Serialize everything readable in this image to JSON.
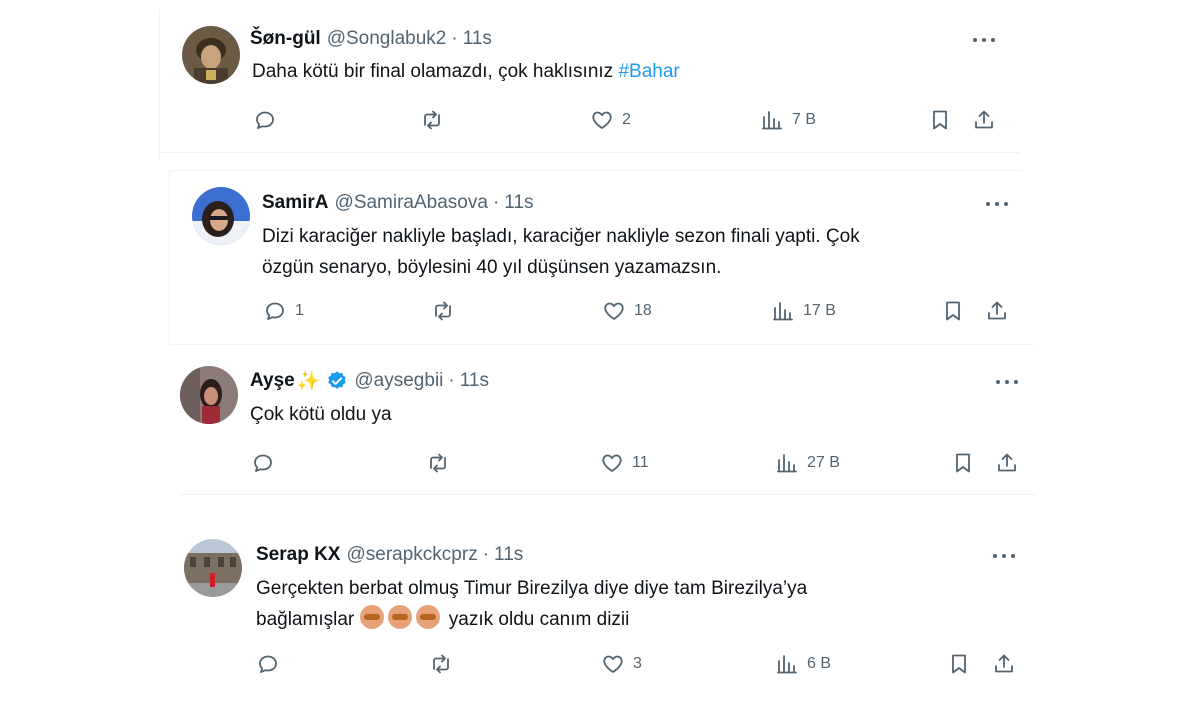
{
  "tweets": [
    {
      "name": "Šøn-gül",
      "handle": "@Songlabuk2",
      "separator": "·",
      "time": "11s",
      "text_before": "Daha kötü bir final olamazdı, çok haklısınız ",
      "hashtag": "#Bahar",
      "replies": "",
      "likes": "2",
      "views": "7 B"
    },
    {
      "name": "SamirA",
      "handle": "@SamiraAbasova",
      "separator": "·",
      "time": "11s",
      "text_line1": "Dizi karaciğer nakliyle başladı, karaciğer nakliyle sezon finali yapti. Çok",
      "text_line2": "özgün senaryo, böylesini 40 yıl düşünsen yazamazsın.",
      "replies": "1",
      "likes": "18",
      "views": "17 B"
    },
    {
      "name": "Ayşe",
      "name_emoji": "✨",
      "handle": "@aysegbii",
      "separator": "·",
      "time": "11s",
      "text": "Çok kötü oldu ya",
      "replies": "",
      "likes": "11",
      "views": "27 B"
    },
    {
      "name": "Serap KX",
      "handle": "@serapkckcprz",
      "separator": "·",
      "time": "11s",
      "text_line1": "Gerçekten berbat olmuş Timur Birezilya diye diye tam Birezilya’ya",
      "text_line2_before": "bağlamışlar",
      "text_line2_after": "yazık oldu canım dizii",
      "emoji_names": [
        "see-no-evil-monkey",
        "see-no-evil-monkey",
        "see-no-evil-monkey"
      ],
      "replies": "",
      "likes": "3",
      "views": "6 B"
    }
  ],
  "icons": {
    "reply": "reply-icon",
    "retweet": "retweet-icon",
    "like": "heart-icon",
    "views": "views-icon",
    "bookmark": "bookmark-icon",
    "share": "share-icon",
    "more": "more-icon"
  },
  "colors": {
    "text": "#0f1419",
    "muted": "#536471",
    "link": "#1d9bf0",
    "verified": "#1d9bf0"
  }
}
